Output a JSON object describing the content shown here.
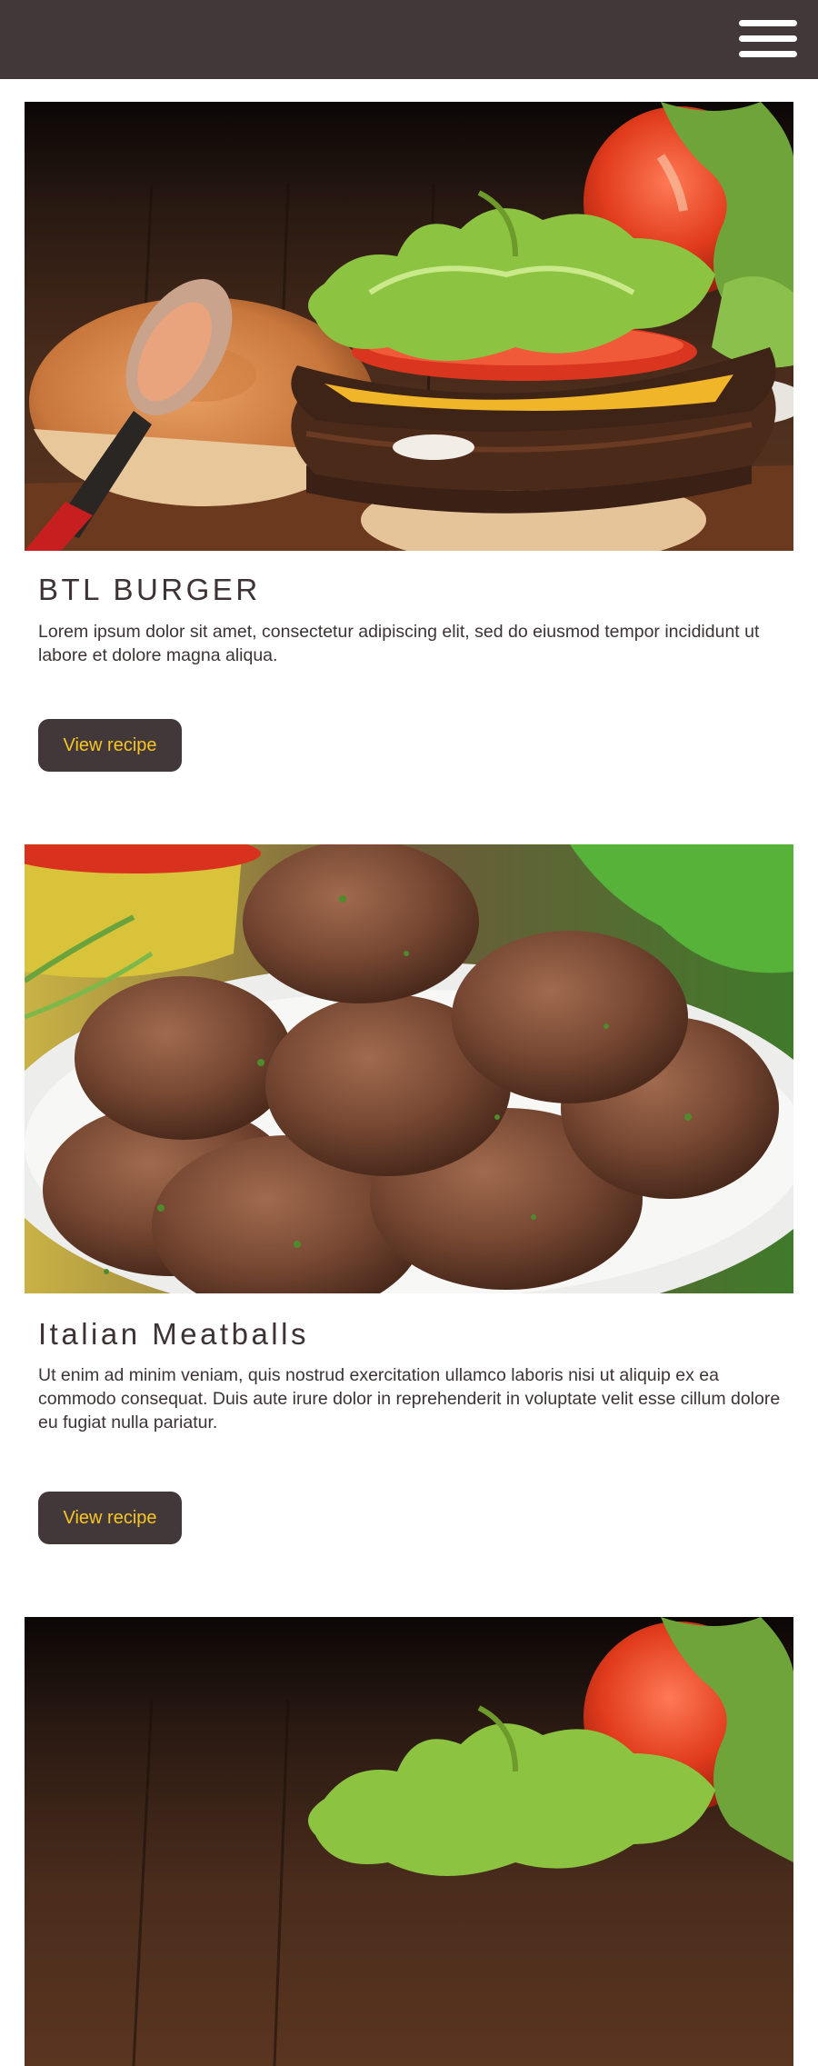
{
  "header": {
    "menu_icon": "hamburger-menu-icon",
    "background_color": "#433839"
  },
  "cards": [
    {
      "title": "BTL BURGER",
      "description": "Lorem ipsum dolor sit amet, consectetur adipiscing elit, sed do eiusmod tempor incididunt ut labore et dolore magna aliqua.",
      "button_label": "View recipe",
      "image_subject": "burger"
    },
    {
      "title": "Italian Meatballs",
      "description": "Ut enim ad minim veniam, quis nostrud exercitation ullamco laboris nisi ut aliquip ex ea commodo consequat. Duis aute irure dolor in reprehenderit in voluptate velit esse cillum dolore eu fugiat nulla pariatur.",
      "button_label": "View recipe",
      "image_subject": "meatballs"
    },
    {
      "title": "",
      "description": "",
      "button_label": "",
      "image_subject": "burger"
    }
  ],
  "theme": {
    "accent_text": "#f6c624",
    "dark": "#433839",
    "text": "#3d3334"
  }
}
